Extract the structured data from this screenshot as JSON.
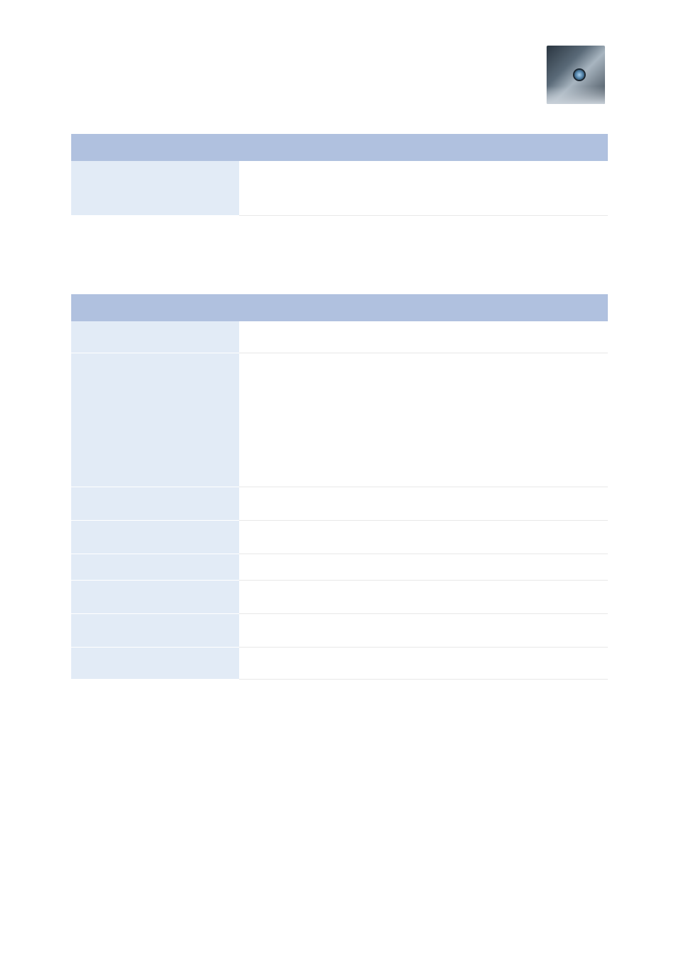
{
  "logo": {
    "name": "wolf-eye-logo"
  },
  "tables": [
    {
      "columns": [
        "",
        ""
      ],
      "rows": [
        {
          "label": "",
          "value": ""
        }
      ]
    },
    {
      "columns": [
        "",
        ""
      ],
      "rows": [
        {
          "label": "",
          "value": ""
        },
        {
          "label": "",
          "value": ""
        },
        {
          "label": "",
          "value": ""
        },
        {
          "label": "",
          "value": ""
        },
        {
          "label": "",
          "value": ""
        },
        {
          "label": "",
          "value": ""
        },
        {
          "label": "",
          "value": ""
        },
        {
          "label": "",
          "value": ""
        }
      ]
    }
  ]
}
